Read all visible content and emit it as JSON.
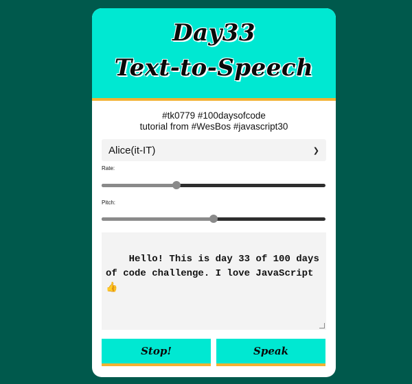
{
  "header": {
    "title_line1": "Day33",
    "title_line2": "Text-to-Speech"
  },
  "subtitle": {
    "line1": "#tk0779 #100daysofcode",
    "line2": "tutorial from #WesBos #javascript30"
  },
  "voice": {
    "selected": "Alice(it-IT)"
  },
  "rate": {
    "label": "Rate:",
    "value": 1,
    "min": 0,
    "max": 3
  },
  "pitch": {
    "label": "Pitch:",
    "value": 1,
    "min": 0,
    "max": 2
  },
  "message": {
    "text": "Hello! This is day 33 of 100 days of code challenge. I love JavaScript 👍"
  },
  "buttons": {
    "stop_label": "Stop!",
    "speak_label": "Speak"
  },
  "colors": {
    "background": "#00594c",
    "accent": "#00e8d2",
    "border_accent": "#f2b233"
  }
}
